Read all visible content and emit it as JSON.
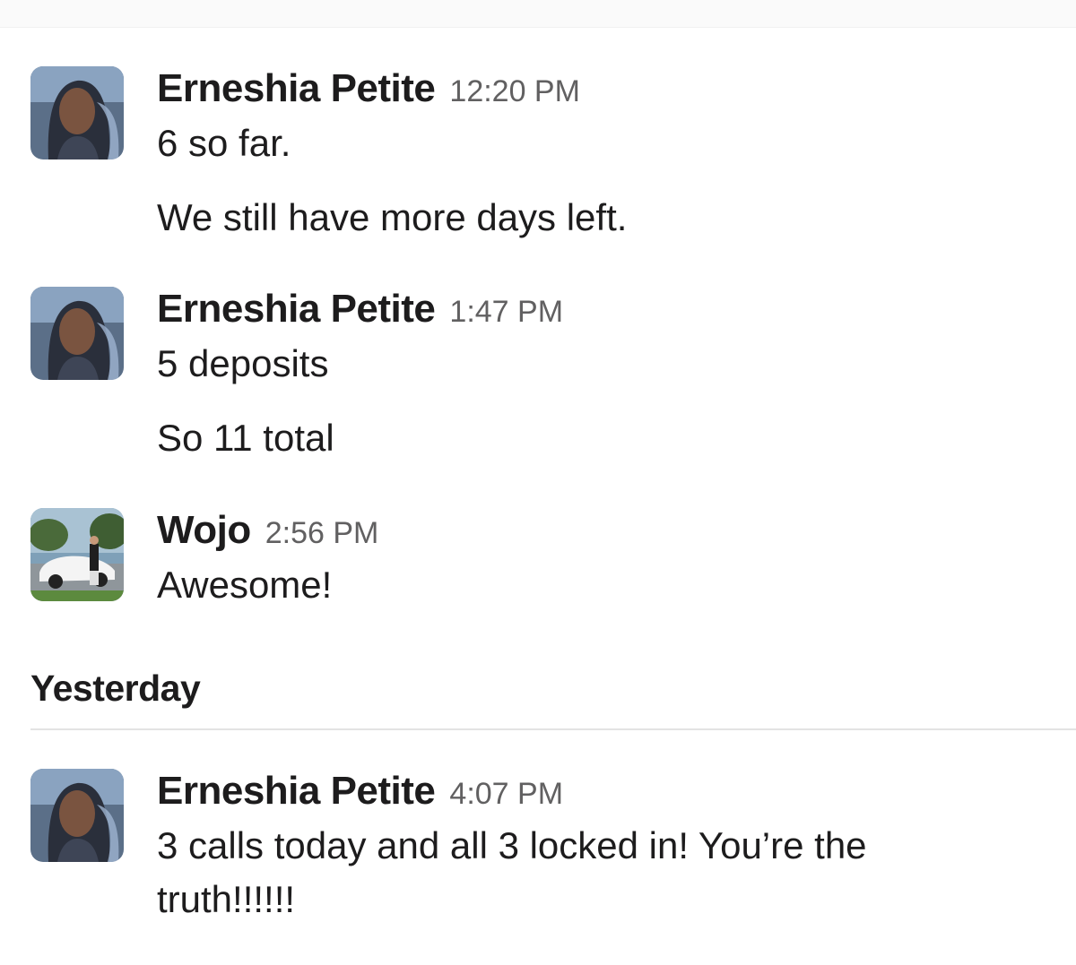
{
  "messages": [
    {
      "sender": "Erneshia Petite",
      "time": "12:20 PM",
      "avatar": "woman-portrait-avatar",
      "lines": [
        "6 so far.",
        "We still have more days left."
      ]
    },
    {
      "sender": "Erneshia Petite",
      "time": "1:47 PM",
      "avatar": "woman-portrait-avatar",
      "lines": [
        "5 deposits",
        "So 11 total"
      ]
    },
    {
      "sender": "Wojo",
      "time": "2:56 PM",
      "avatar": "car-photo-avatar",
      "lines": [
        "Awesome!"
      ]
    }
  ],
  "day_divider": {
    "label": "Yesterday"
  },
  "yesterday_messages": [
    {
      "sender": "Erneshia Petite",
      "time": "4:07 PM",
      "avatar": "woman-portrait-avatar",
      "lines": [
        "3 calls today and all 3 locked in! You’re the",
        "truth!!!!!!"
      ]
    }
  ],
  "colors": {
    "text": "#1d1c1d",
    "timestamp": "#616061",
    "divider": "#e3e3e3"
  }
}
